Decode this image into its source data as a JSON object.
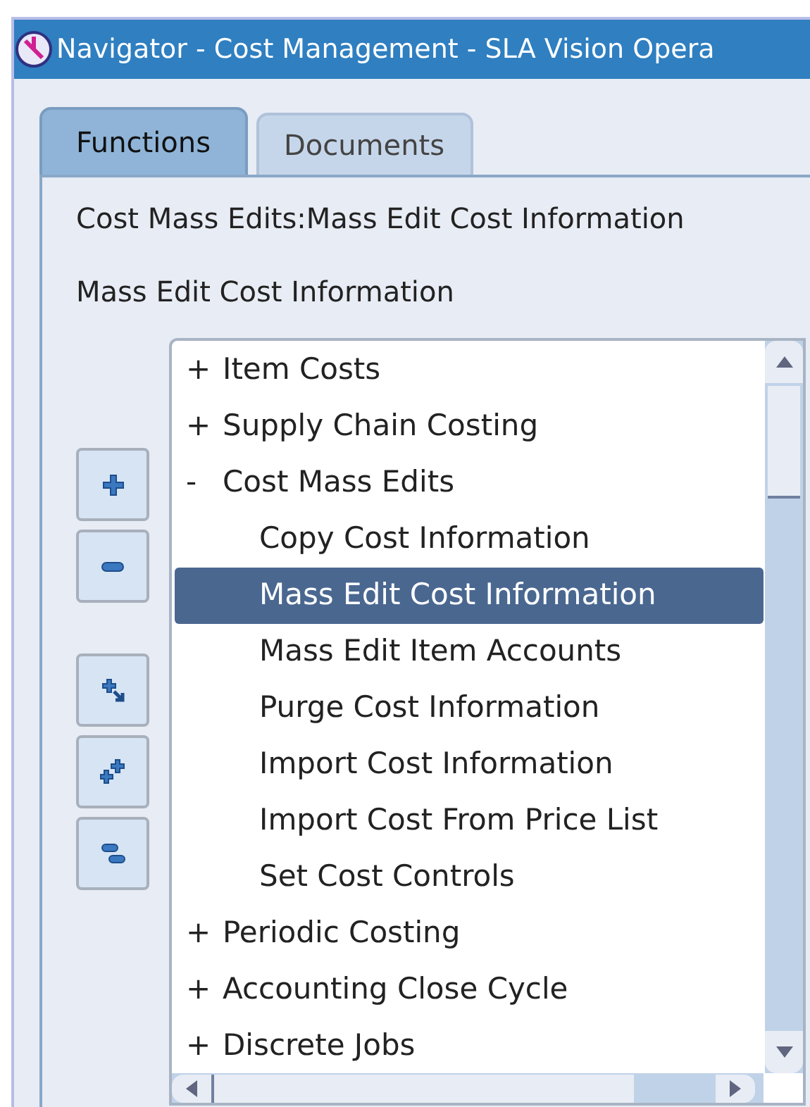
{
  "window": {
    "title": "Navigator - Cost Management - SLA Vision Opera"
  },
  "tabs": [
    {
      "label": "Functions",
      "selected": true
    },
    {
      "label": "Documents",
      "selected": false
    }
  ],
  "path": "Cost Mass Edits:Mass Edit Cost Information",
  "current": "Mass Edit Cost Information",
  "tool_buttons": [
    {
      "kind": "expand"
    },
    {
      "kind": "collapse"
    },
    {
      "kind": "expand-branch"
    },
    {
      "kind": "expand-all"
    },
    {
      "kind": "collapse-all"
    }
  ],
  "tree": [
    {
      "marker": "+",
      "label": "Item Costs",
      "selected": false
    },
    {
      "marker": "+",
      "label": "Supply Chain Costing",
      "selected": false
    },
    {
      "marker": "-",
      "label": "Cost Mass Edits",
      "selected": false,
      "children": [
        {
          "label": "Copy Cost Information",
          "selected": false
        },
        {
          "label": "Mass Edit Cost Information",
          "selected": true
        },
        {
          "label": "Mass Edit Item Accounts",
          "selected": false
        },
        {
          "label": "Purge Cost Information",
          "selected": false
        },
        {
          "label": "Import Cost Information",
          "selected": false
        },
        {
          "label": "Import Cost From Price List",
          "selected": false
        },
        {
          "label": "Set Cost Controls",
          "selected": false
        }
      ]
    },
    {
      "marker": "+",
      "label": "Periodic Costing",
      "selected": false
    },
    {
      "marker": "+",
      "label": "Accounting Close Cycle",
      "selected": false
    },
    {
      "marker": "+",
      "label": "Discrete Jobs",
      "selected": false
    }
  ]
}
